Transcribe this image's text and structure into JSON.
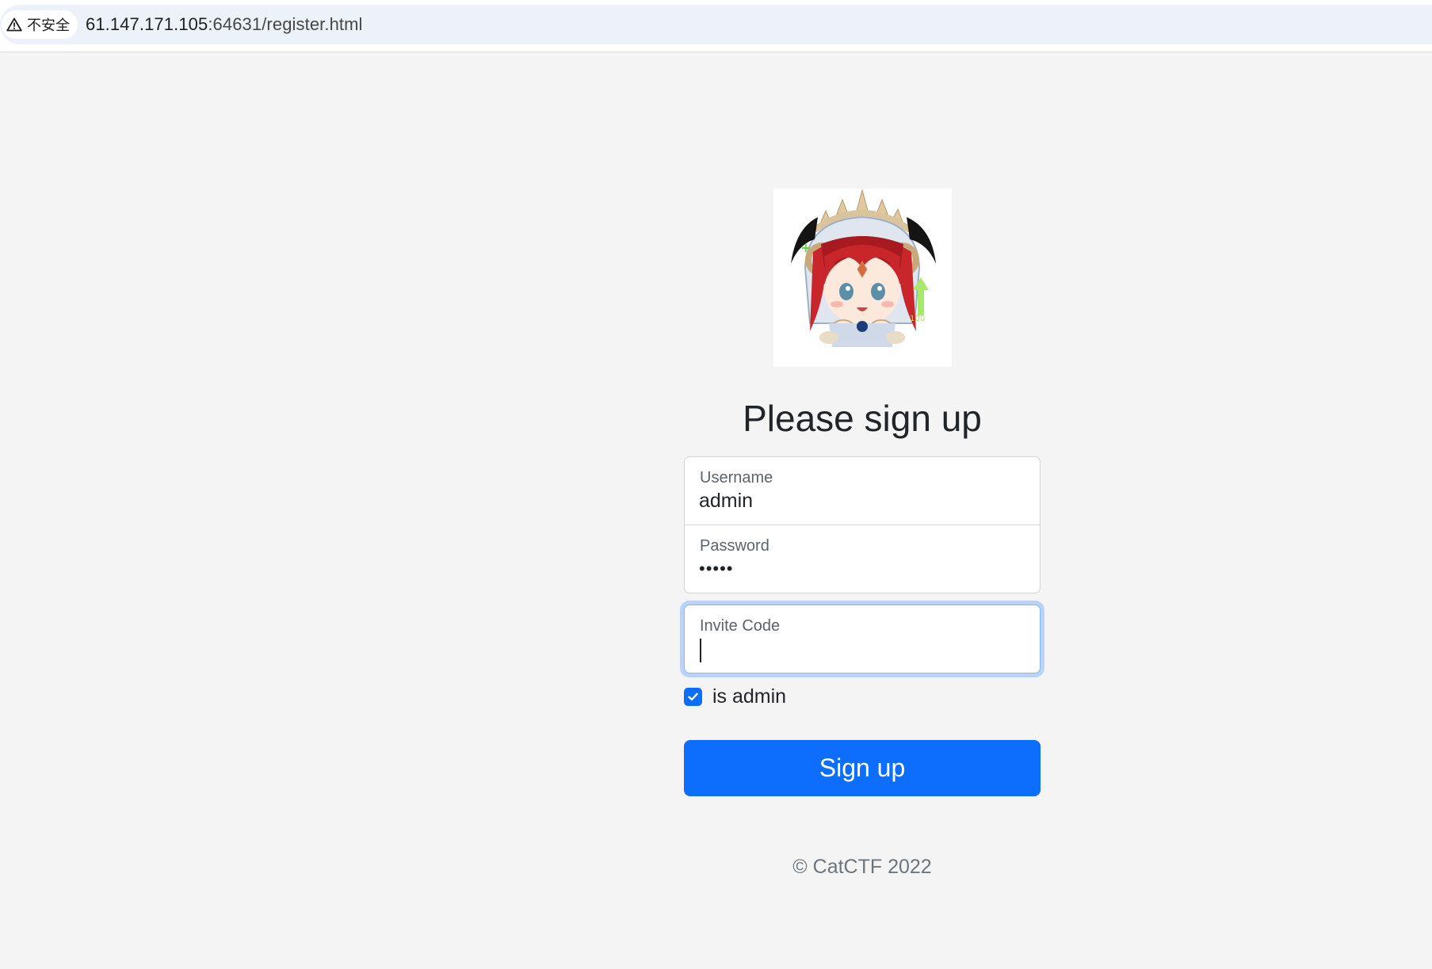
{
  "browser": {
    "security_label": "不安全",
    "url_host": "61.147.171.105",
    "url_rest": ":64631/register.html"
  },
  "form": {
    "heading": "Please sign up",
    "username": {
      "label": "Username",
      "value": "admin"
    },
    "password": {
      "label": "Password",
      "value": "•••••"
    },
    "invite_code": {
      "label": "Invite Code",
      "value": ""
    },
    "is_admin": {
      "label": "is admin",
      "checked": true
    },
    "submit_label": "Sign up"
  },
  "footer": {
    "text": "© CatCTF 2022"
  },
  "colors": {
    "primary": "#0d6efd",
    "page_bg": "#f4f4f4",
    "focus_border": "#86b7fe"
  },
  "icons": {
    "security": "warning-triangle-icon",
    "checkbox": "checkmark-icon",
    "logo": "anime-character-logo"
  }
}
